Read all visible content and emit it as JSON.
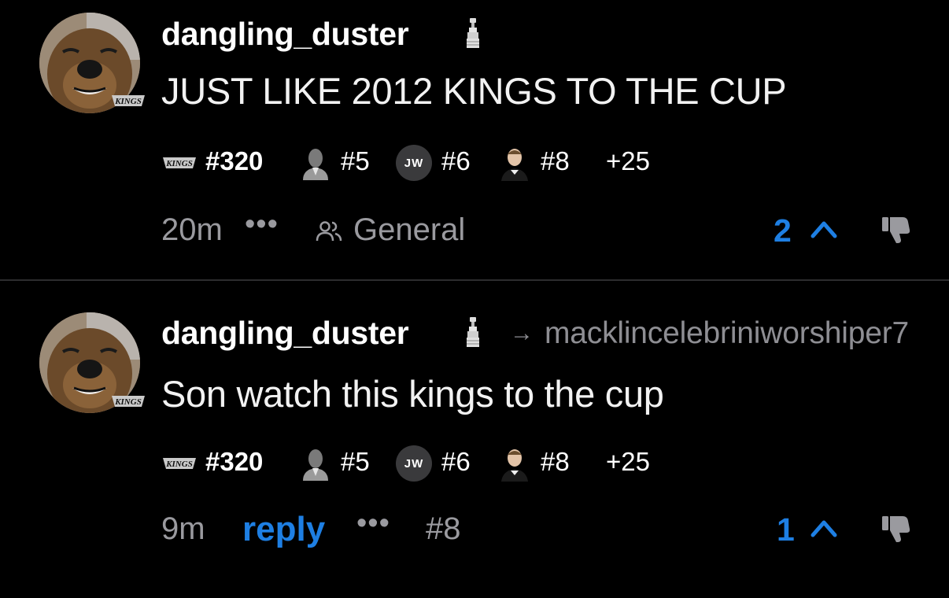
{
  "colors": {
    "background": "#000000",
    "accent": "#1e7fe3",
    "muted": "#9a9a9f",
    "divider": "#2c2c2e"
  },
  "posts": [
    {
      "username": "dangling_duster",
      "text": "JUST LIKE 2012 KINGS TO THE CUP",
      "flair": {
        "team_number": "#320",
        "player1": "#5",
        "player2_initials": "JW",
        "player2": "#6",
        "player3": "#8",
        "more": "+25"
      },
      "time": "20m",
      "more": "•••",
      "group": "General",
      "votes": "2"
    },
    {
      "username": "dangling_duster",
      "reply_arrow": "→",
      "reply_to": "macklincelebriniworshiper7",
      "text": "Son watch this kings to the cup",
      "flair": {
        "team_number": "#320",
        "player1": "#5",
        "player2_initials": "JW",
        "player2": "#6",
        "player3": "#8",
        "more": "+25"
      },
      "time": "9m",
      "reply_label": "reply",
      "more": "•••",
      "ref": "#8",
      "votes": "1"
    }
  ]
}
